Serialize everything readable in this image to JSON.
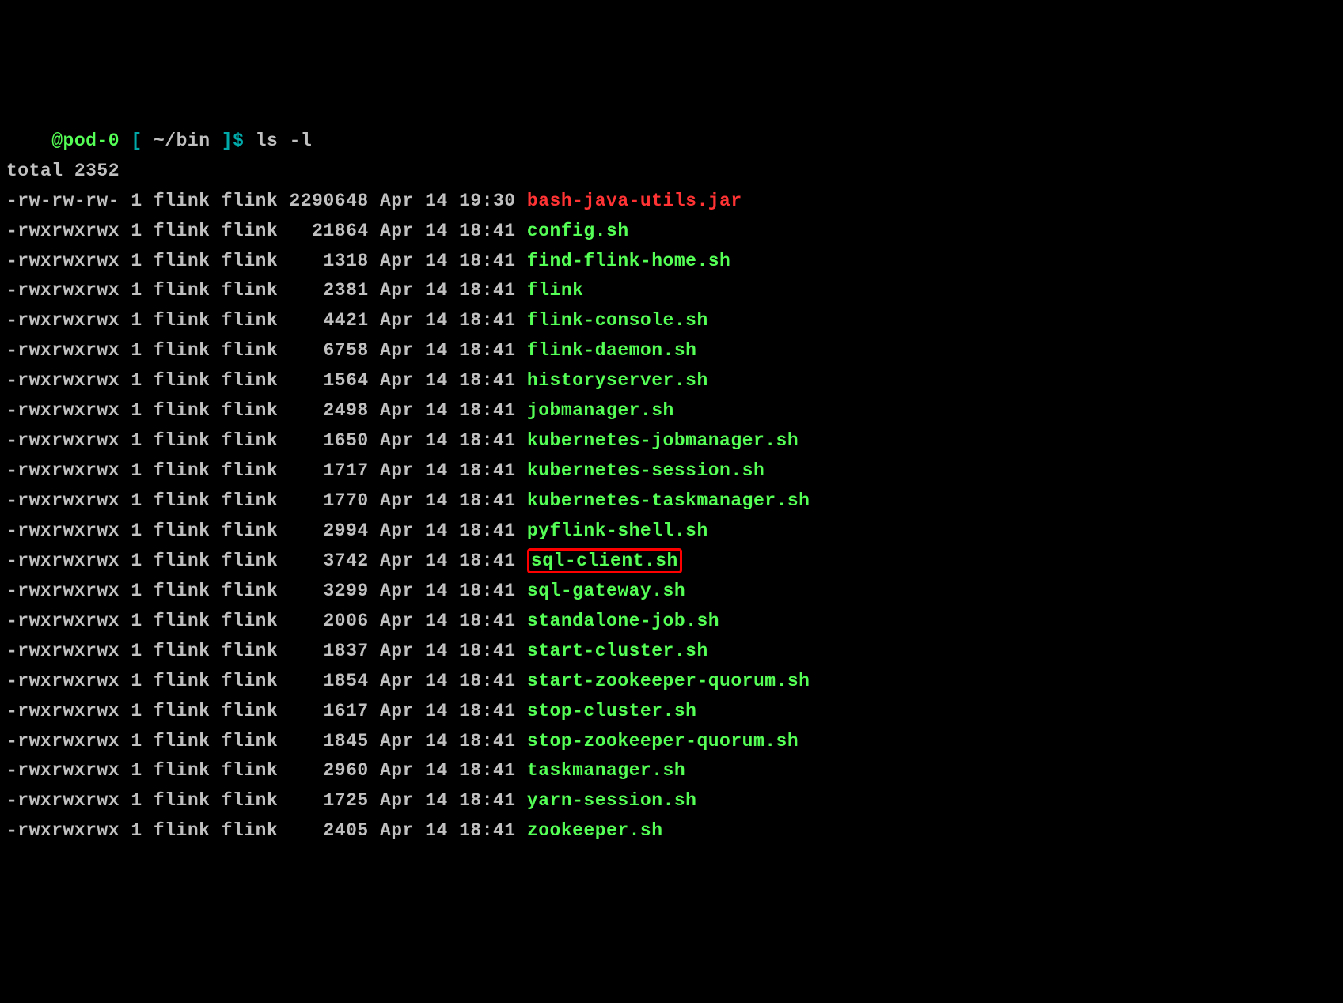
{
  "prompt": {
    "user": "@pod-0",
    "open_bracket": "[",
    "path": "~/bin",
    "close_bracket": "]$",
    "command": "ls -l"
  },
  "total_line": "total 2352",
  "files": [
    {
      "perms": "-rw-rw-rw-",
      "links": "1",
      "owner": "flink",
      "group": "flink",
      "size": "2290648",
      "month": "Apr",
      "day": "14",
      "time": "19:30",
      "name": "bash-java-utils.jar",
      "color": "red",
      "highlight": false
    },
    {
      "perms": "-rwxrwxrwx",
      "links": "1",
      "owner": "flink",
      "group": "flink",
      "size": "21864",
      "month": "Apr",
      "day": "14",
      "time": "18:41",
      "name": "config.sh",
      "color": "green",
      "highlight": false
    },
    {
      "perms": "-rwxrwxrwx",
      "links": "1",
      "owner": "flink",
      "group": "flink",
      "size": "1318",
      "month": "Apr",
      "day": "14",
      "time": "18:41",
      "name": "find-flink-home.sh",
      "color": "green",
      "highlight": false
    },
    {
      "perms": "-rwxrwxrwx",
      "links": "1",
      "owner": "flink",
      "group": "flink",
      "size": "2381",
      "month": "Apr",
      "day": "14",
      "time": "18:41",
      "name": "flink",
      "color": "green",
      "highlight": false
    },
    {
      "perms": "-rwxrwxrwx",
      "links": "1",
      "owner": "flink",
      "group": "flink",
      "size": "4421",
      "month": "Apr",
      "day": "14",
      "time": "18:41",
      "name": "flink-console.sh",
      "color": "green",
      "highlight": false
    },
    {
      "perms": "-rwxrwxrwx",
      "links": "1",
      "owner": "flink",
      "group": "flink",
      "size": "6758",
      "month": "Apr",
      "day": "14",
      "time": "18:41",
      "name": "flink-daemon.sh",
      "color": "green",
      "highlight": false
    },
    {
      "perms": "-rwxrwxrwx",
      "links": "1",
      "owner": "flink",
      "group": "flink",
      "size": "1564",
      "month": "Apr",
      "day": "14",
      "time": "18:41",
      "name": "historyserver.sh",
      "color": "green",
      "highlight": false
    },
    {
      "perms": "-rwxrwxrwx",
      "links": "1",
      "owner": "flink",
      "group": "flink",
      "size": "2498",
      "month": "Apr",
      "day": "14",
      "time": "18:41",
      "name": "jobmanager.sh",
      "color": "green",
      "highlight": false
    },
    {
      "perms": "-rwxrwxrwx",
      "links": "1",
      "owner": "flink",
      "group": "flink",
      "size": "1650",
      "month": "Apr",
      "day": "14",
      "time": "18:41",
      "name": "kubernetes-jobmanager.sh",
      "color": "green",
      "highlight": false
    },
    {
      "perms": "-rwxrwxrwx",
      "links": "1",
      "owner": "flink",
      "group": "flink",
      "size": "1717",
      "month": "Apr",
      "day": "14",
      "time": "18:41",
      "name": "kubernetes-session.sh",
      "color": "green",
      "highlight": false
    },
    {
      "perms": "-rwxrwxrwx",
      "links": "1",
      "owner": "flink",
      "group": "flink",
      "size": "1770",
      "month": "Apr",
      "day": "14",
      "time": "18:41",
      "name": "kubernetes-taskmanager.sh",
      "color": "green",
      "highlight": false
    },
    {
      "perms": "-rwxrwxrwx",
      "links": "1",
      "owner": "flink",
      "group": "flink",
      "size": "2994",
      "month": "Apr",
      "day": "14",
      "time": "18:41",
      "name": "pyflink-shell.sh",
      "color": "green",
      "highlight": false
    },
    {
      "perms": "-rwxrwxrwx",
      "links": "1",
      "owner": "flink",
      "group": "flink",
      "size": "3742",
      "month": "Apr",
      "day": "14",
      "time": "18:41",
      "name": "sql-client.sh",
      "color": "green",
      "highlight": true
    },
    {
      "perms": "-rwxrwxrwx",
      "links": "1",
      "owner": "flink",
      "group": "flink",
      "size": "3299",
      "month": "Apr",
      "day": "14",
      "time": "18:41",
      "name": "sql-gateway.sh",
      "color": "green",
      "highlight": false
    },
    {
      "perms": "-rwxrwxrwx",
      "links": "1",
      "owner": "flink",
      "group": "flink",
      "size": "2006",
      "month": "Apr",
      "day": "14",
      "time": "18:41",
      "name": "standalone-job.sh",
      "color": "green",
      "highlight": false
    },
    {
      "perms": "-rwxrwxrwx",
      "links": "1",
      "owner": "flink",
      "group": "flink",
      "size": "1837",
      "month": "Apr",
      "day": "14",
      "time": "18:41",
      "name": "start-cluster.sh",
      "color": "green",
      "highlight": false
    },
    {
      "perms": "-rwxrwxrwx",
      "links": "1",
      "owner": "flink",
      "group": "flink",
      "size": "1854",
      "month": "Apr",
      "day": "14",
      "time": "18:41",
      "name": "start-zookeeper-quorum.sh",
      "color": "green",
      "highlight": false
    },
    {
      "perms": "-rwxrwxrwx",
      "links": "1",
      "owner": "flink",
      "group": "flink",
      "size": "1617",
      "month": "Apr",
      "day": "14",
      "time": "18:41",
      "name": "stop-cluster.sh",
      "color": "green",
      "highlight": false
    },
    {
      "perms": "-rwxrwxrwx",
      "links": "1",
      "owner": "flink",
      "group": "flink",
      "size": "1845",
      "month": "Apr",
      "day": "14",
      "time": "18:41",
      "name": "stop-zookeeper-quorum.sh",
      "color": "green",
      "highlight": false
    },
    {
      "perms": "-rwxrwxrwx",
      "links": "1",
      "owner": "flink",
      "group": "flink",
      "size": "2960",
      "month": "Apr",
      "day": "14",
      "time": "18:41",
      "name": "taskmanager.sh",
      "color": "green",
      "highlight": false
    },
    {
      "perms": "-rwxrwxrwx",
      "links": "1",
      "owner": "flink",
      "group": "flink",
      "size": "1725",
      "month": "Apr",
      "day": "14",
      "time": "18:41",
      "name": "yarn-session.sh",
      "color": "green",
      "highlight": false
    },
    {
      "perms": "-rwxrwxrwx",
      "links": "1",
      "owner": "flink",
      "group": "flink",
      "size": "2405",
      "month": "Apr",
      "day": "14",
      "time": "18:41",
      "name": "zookeeper.sh",
      "color": "green",
      "highlight": false
    }
  ]
}
